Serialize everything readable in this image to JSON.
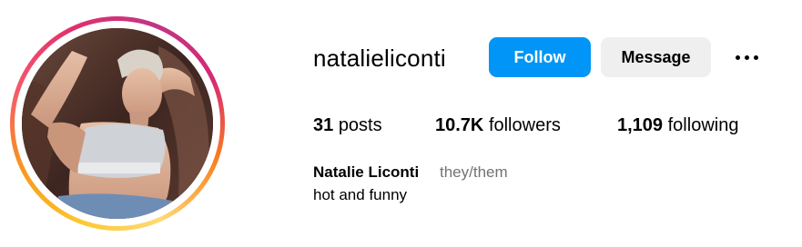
{
  "profile": {
    "username": "natalieliconti",
    "display_name": "Natalie Liconti",
    "pronouns": "they/them",
    "bio": "hot and funny",
    "avatar_icon": "profile-photo",
    "story_ring_colors": [
      "#fdc830",
      "#f7971e",
      "#e1306c",
      "#c13584"
    ]
  },
  "actions": {
    "follow_label": "Follow",
    "message_label": "Message",
    "more_icon": "more-horizontal-icon",
    "follow_color": "#0095f6",
    "message_color": "#efefef"
  },
  "stats": {
    "posts": {
      "count": "31",
      "label": "posts"
    },
    "followers": {
      "count": "10.7K",
      "label": "followers"
    },
    "following": {
      "count": "1,109",
      "label": "following"
    }
  }
}
